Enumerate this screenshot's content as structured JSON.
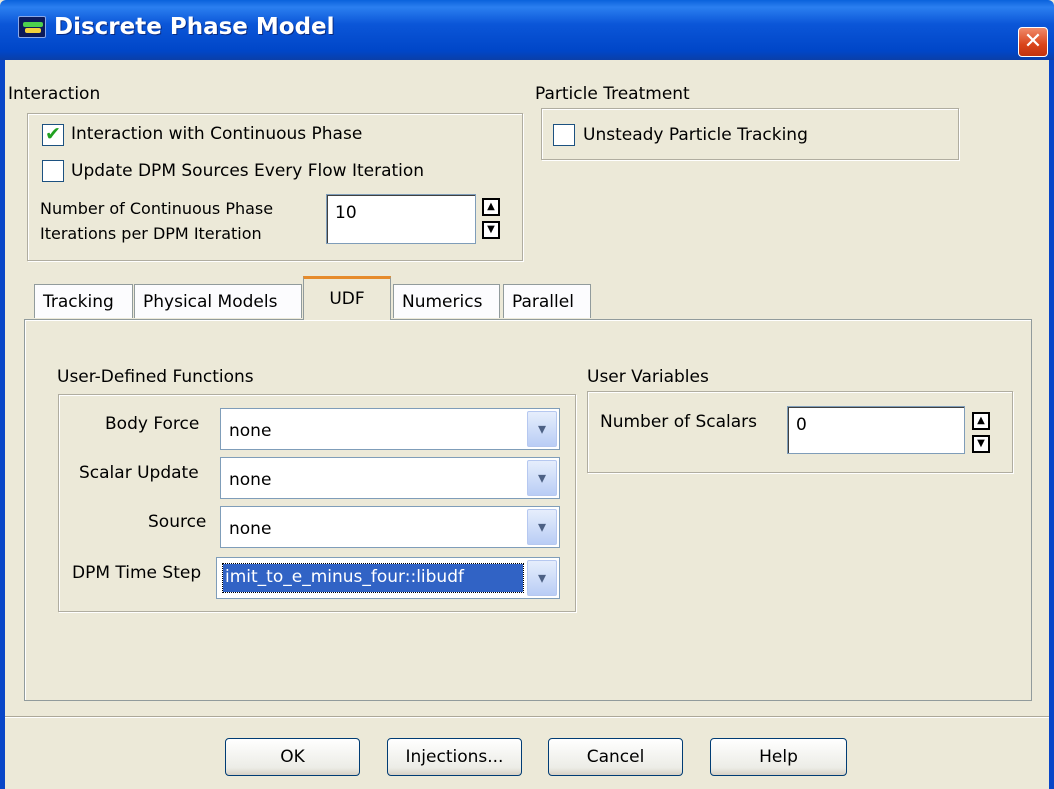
{
  "window": {
    "title": "Discrete Phase Model",
    "close_symbol": "✕"
  },
  "interaction": {
    "label": "Interaction",
    "interaction_continuous": {
      "label": "Interaction with Continuous Phase",
      "checked": true
    },
    "update_sources": {
      "label": "Update DPM Sources Every Flow Iteration",
      "checked": false
    },
    "iterations_label_line1": "Number of Continuous Phase",
    "iterations_label_line2": "Iterations per DPM Iteration",
    "iterations_value": "10"
  },
  "particle_treatment": {
    "label": "Particle Treatment",
    "unsteady": {
      "label": "Unsteady Particle Tracking",
      "checked": false
    }
  },
  "tabs": [
    {
      "label": "Tracking",
      "active": false
    },
    {
      "label": "Physical Models",
      "active": false
    },
    {
      "label": "UDF",
      "active": true
    },
    {
      "label": "Numerics",
      "active": false
    },
    {
      "label": "Parallel",
      "active": false
    }
  ],
  "udf": {
    "label": "User-Defined Functions",
    "body_force": {
      "label": "Body Force",
      "value": "none"
    },
    "scalar_update": {
      "label": "Scalar Update",
      "value": "none"
    },
    "source": {
      "label": "Source",
      "value": "none"
    },
    "dpm_time_step": {
      "label": "DPM Time Step",
      "value": "imit_to_e_minus_four::libudf"
    }
  },
  "user_variables": {
    "label": "User Variables",
    "num_scalars_label": "Number of Scalars",
    "num_scalars_value": "0"
  },
  "buttons": {
    "ok": "OK",
    "injections": "Injections...",
    "cancel": "Cancel",
    "help": "Help"
  },
  "icons": {
    "dropdown_arrow": "chevron-down-icon",
    "spin_up": "spin-up-icon",
    "spin_down": "spin-down-icon",
    "check": "check-icon"
  },
  "colors": {
    "titlebar": "#0054e3",
    "selection": "#3163c5",
    "active_tab_accent": "#e68b2c",
    "close": "#d9441a"
  }
}
